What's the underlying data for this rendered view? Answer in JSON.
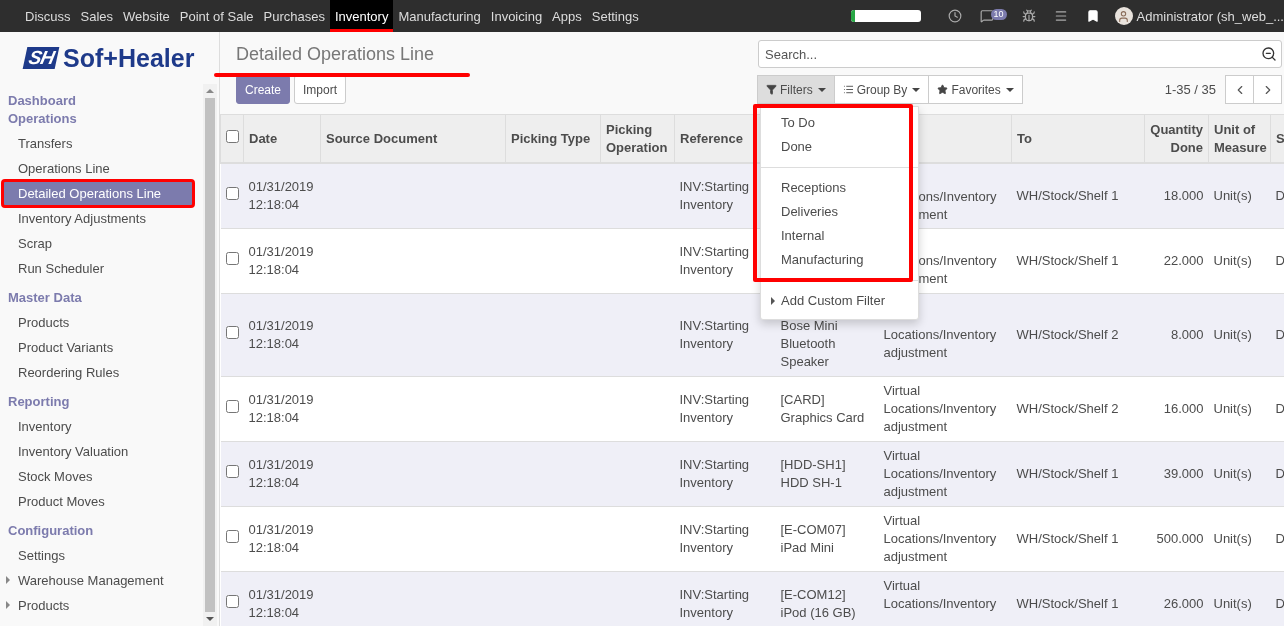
{
  "navbar": {
    "apps": [
      {
        "label": "Discuss",
        "selected": false,
        "annotated": false
      },
      {
        "label": "Sales",
        "selected": false,
        "annotated": false
      },
      {
        "label": "Website",
        "selected": false,
        "annotated": false
      },
      {
        "label": "Point of Sale",
        "selected": false,
        "annotated": false
      },
      {
        "label": "Purchases",
        "selected": false,
        "annotated": false
      },
      {
        "label": "Inventory",
        "selected": true,
        "annotated": true
      },
      {
        "label": "Manufacturing",
        "selected": false,
        "annotated": false
      },
      {
        "label": "Invoicing",
        "selected": false,
        "annotated": false
      },
      {
        "label": "Apps",
        "selected": false,
        "annotated": false
      },
      {
        "label": "Settings",
        "selected": false,
        "annotated": false
      }
    ],
    "progress": {
      "level": 0.06
    },
    "messages_badge": "10",
    "user": "Administrator (sh_web_..."
  },
  "logo": {
    "mark": "SH",
    "name": "Sof+Healer"
  },
  "sidebar": {
    "sections": [
      {
        "title": "Dashboard Operations",
        "items": [
          {
            "label": "Transfers",
            "selected": false,
            "annotated": false,
            "expandable": false
          },
          {
            "label": "Operations Line",
            "selected": false,
            "annotated": false,
            "expandable": false
          },
          {
            "label": "Detailed Operations Line",
            "selected": true,
            "annotated": true,
            "expandable": false
          },
          {
            "label": "Inventory Adjustments",
            "selected": false,
            "annotated": false,
            "expandable": false
          },
          {
            "label": "Scrap",
            "selected": false,
            "annotated": false,
            "expandable": false
          },
          {
            "label": "Run Scheduler",
            "selected": false,
            "annotated": false,
            "expandable": false
          }
        ]
      },
      {
        "title": "Master Data",
        "items": [
          {
            "label": "Products",
            "selected": false,
            "annotated": false,
            "expandable": false
          },
          {
            "label": "Product Variants",
            "selected": false,
            "annotated": false,
            "expandable": false
          },
          {
            "label": "Reordering Rules",
            "selected": false,
            "annotated": false,
            "expandable": false
          }
        ]
      },
      {
        "title": "Reporting",
        "items": [
          {
            "label": "Inventory",
            "selected": false,
            "annotated": false,
            "expandable": false
          },
          {
            "label": "Inventory Valuation",
            "selected": false,
            "annotated": false,
            "expandable": false
          },
          {
            "label": "Stock Moves",
            "selected": false,
            "annotated": false,
            "expandable": false
          },
          {
            "label": "Product Moves",
            "selected": false,
            "annotated": false,
            "expandable": false
          }
        ]
      },
      {
        "title": "Configuration",
        "items": [
          {
            "label": "Settings",
            "selected": false,
            "annotated": false,
            "expandable": false
          },
          {
            "label": "Warehouse Management",
            "selected": false,
            "annotated": false,
            "expandable": true
          },
          {
            "label": "Products",
            "selected": false,
            "annotated": false,
            "expandable": true
          }
        ]
      }
    ]
  },
  "control_panel": {
    "title": "Detailed Operations Line",
    "title_annotated": true,
    "buttons": [
      {
        "label": "Create",
        "kind": "primary"
      },
      {
        "label": "Import",
        "kind": "secondary"
      }
    ],
    "search": {
      "placeholder": "Search..."
    },
    "search_options": [
      {
        "label": "Filters",
        "kind": "filter",
        "selected": true
      },
      {
        "label": "Group By",
        "kind": "group",
        "selected": false
      },
      {
        "label": "Favorites",
        "kind": "star",
        "selected": false
      }
    ],
    "pager": "1-35 / 35"
  },
  "filters_menu": {
    "annotated": true,
    "groups": [
      [
        "To Do",
        "Done"
      ],
      [
        "Receptions",
        "Deliveries",
        "Internal",
        "Manufacturing"
      ]
    ],
    "custom": "Add Custom Filter"
  },
  "table": {
    "select_all": {
      "checked": false
    },
    "columns": [
      {
        "label": "Date",
        "kind": "text"
      },
      {
        "label": "Source Document",
        "kind": "text"
      },
      {
        "label": "Picking Type",
        "kind": "text"
      },
      {
        "label": "Picking Operation",
        "kind": "text"
      },
      {
        "label": "Reference",
        "kind": "text"
      },
      {
        "kind": "covered"
      },
      {
        "kind": "covered"
      },
      {
        "label": "To",
        "kind": "text"
      },
      {
        "label": "Quantity Done",
        "kind": "number"
      },
      {
        "label": "Unit of Measure",
        "kind": "text"
      },
      {
        "label": "S",
        "kind": "text"
      }
    ],
    "rows": [
      {
        "checked": false,
        "date": [
          "01/31/2019",
          "12:18:04"
        ],
        "reference": [
          "INV:Starting",
          "Inventory"
        ],
        "from": [
          "ons/Inventory",
          "ment"
        ],
        "covered": true,
        "to": "WH/Stock/Shelf 1",
        "qty": "18.000",
        "uom": "Unit(s)",
        "column_12": "D"
      },
      {
        "checked": false,
        "date": [
          "01/31/2019",
          "12:18:04"
        ],
        "reference": [
          "INV:Starting",
          "Inventory"
        ],
        "from": [
          "ons/Inventory",
          "ment"
        ],
        "covered": true,
        "to": "WH/Stock/Shelf 1",
        "qty": "22.000",
        "uom": "Unit(s)",
        "column_12": "D"
      },
      {
        "checked": false,
        "date": [
          "01/31/2019",
          "12:18:04"
        ],
        "reference": [
          "INV:Starting",
          "Inventory"
        ],
        "product": [
          "Bose Mini",
          "Bluetooth",
          "Speaker"
        ],
        "from": [
          "Locations/Inventory",
          "adjustment"
        ],
        "covered": true,
        "to": "WH/Stock/Shelf 2",
        "qty": "8.000",
        "uom": "Unit(s)",
        "column_12": "D"
      },
      {
        "checked": false,
        "date": [
          "01/31/2019",
          "12:18:04"
        ],
        "reference": [
          "INV:Starting",
          "Inventory"
        ],
        "product": [
          "[CARD]",
          "Graphics Card"
        ],
        "from": [
          "Virtual",
          "Locations/Inventory",
          "adjustment"
        ],
        "covered": false,
        "to": "WH/Stock/Shelf 2",
        "qty": "16.000",
        "uom": "Unit(s)",
        "column_12": "D"
      },
      {
        "checked": false,
        "date": [
          "01/31/2019",
          "12:18:04"
        ],
        "reference": [
          "INV:Starting",
          "Inventory"
        ],
        "product": [
          "[HDD-SH1]",
          "HDD SH-1"
        ],
        "from": [
          "Virtual",
          "Locations/Inventory",
          "adjustment"
        ],
        "covered": false,
        "to": "WH/Stock/Shelf 1",
        "qty": "39.000",
        "uom": "Unit(s)",
        "column_12": "D"
      },
      {
        "checked": false,
        "date": [
          "01/31/2019",
          "12:18:04"
        ],
        "reference": [
          "INV:Starting",
          "Inventory"
        ],
        "product": [
          "[E-COM07]",
          "iPad Mini"
        ],
        "from": [
          "Virtual",
          "Locations/Inventory",
          "adjustment"
        ],
        "covered": false,
        "to": "WH/Stock/Shelf 1",
        "qty": "500.000",
        "uom": "Unit(s)",
        "column_12": "D"
      },
      {
        "checked": false,
        "date": [
          "01/31/2019",
          "12:18:04"
        ],
        "reference": [
          "INV:Starting",
          "Inventory"
        ],
        "product": [
          "[E-COM12]",
          "iPod (16 GB)"
        ],
        "from": [
          "Virtual",
          "Locations/Inventory"
        ],
        "covered": false,
        "to": "WH/Stock/Shelf 1",
        "qty": "26.000",
        "uom": "Unit(s)",
        "column_12": "D"
      }
    ]
  }
}
